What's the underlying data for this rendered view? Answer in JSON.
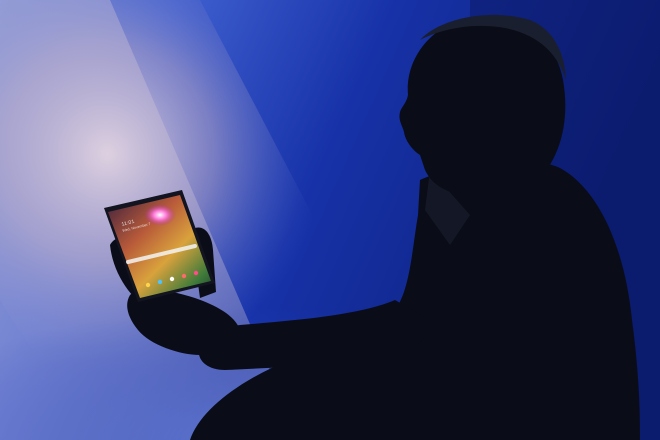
{
  "image": {
    "subject": "silhouetted-presenter-holding-foldable-phone",
    "background_palette": [
      "#1a3cb8",
      "#0a1a5e",
      "#c9b9c9",
      "#6b87d6"
    ],
    "phone_screen": {
      "time_text": "11:01",
      "date_text": "Wed, November 7"
    }
  }
}
